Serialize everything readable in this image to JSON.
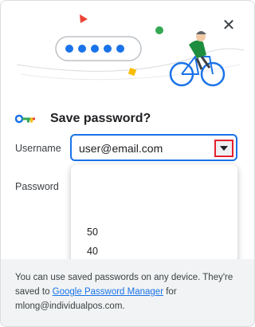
{
  "dialog": {
    "title": "Save password?",
    "close_symbol": "✕",
    "username_label": "Username",
    "username_value": "user@email.com",
    "password_label": "Password",
    "dropdown_options": [
      "50",
      "40"
    ],
    "footer": {
      "text_before": "You can use saved passwords on any device. They're saved to ",
      "link": "Google Password Manager",
      "text_after": " for mlong@individualpos.com."
    }
  },
  "colors": {
    "accent": "#1a73e8",
    "highlight_border": "#e5202e",
    "footer_bg": "#f1f3f4"
  },
  "icons": [
    "close-icon",
    "key-icon",
    "chevron-down-icon"
  ]
}
